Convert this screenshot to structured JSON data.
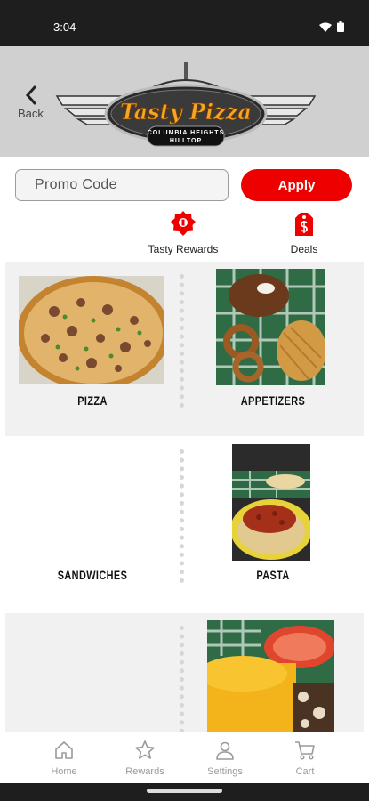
{
  "status_bar": {
    "time": "3:04",
    "icons": [
      "wifi-icon",
      "battery-icon"
    ]
  },
  "header": {
    "back_label": "Back",
    "logo": {
      "title": "Tasty Pizza",
      "subtitle_line1": "COLUMBIA HEIGHTS",
      "subtitle_line2": "HILLTOP"
    }
  },
  "promo": {
    "placeholder": "Promo Code",
    "value": "",
    "apply_label": "Apply"
  },
  "quick_links": [
    {
      "label": "Tasty Rewards",
      "icon": "rewards-badge-icon"
    },
    {
      "label": "Deals",
      "icon": "deals-tag-icon"
    }
  ],
  "categories": [
    {
      "label": "PIZZA",
      "image": "pizza-photo"
    },
    {
      "label": "APPETIZERS",
      "image": "appetizers-photo"
    },
    {
      "label": "SANDWICHES",
      "image": ""
    },
    {
      "label": "PASTA",
      "image": "pasta-photo"
    },
    {
      "label": "",
      "image": ""
    },
    {
      "label": "",
      "image": "burger-photo"
    }
  ],
  "bottom_nav": [
    {
      "label": "Home",
      "icon": "home-icon"
    },
    {
      "label": "Rewards",
      "icon": "star-icon"
    },
    {
      "label": "Settings",
      "icon": "person-icon"
    },
    {
      "label": "Cart",
      "icon": "cart-icon"
    }
  ],
  "colors": {
    "accent": "#ef0000",
    "header_bg": "#d0d0d0",
    "status_bar": "#1e1e1e",
    "logo_gold": "#f5a623"
  }
}
